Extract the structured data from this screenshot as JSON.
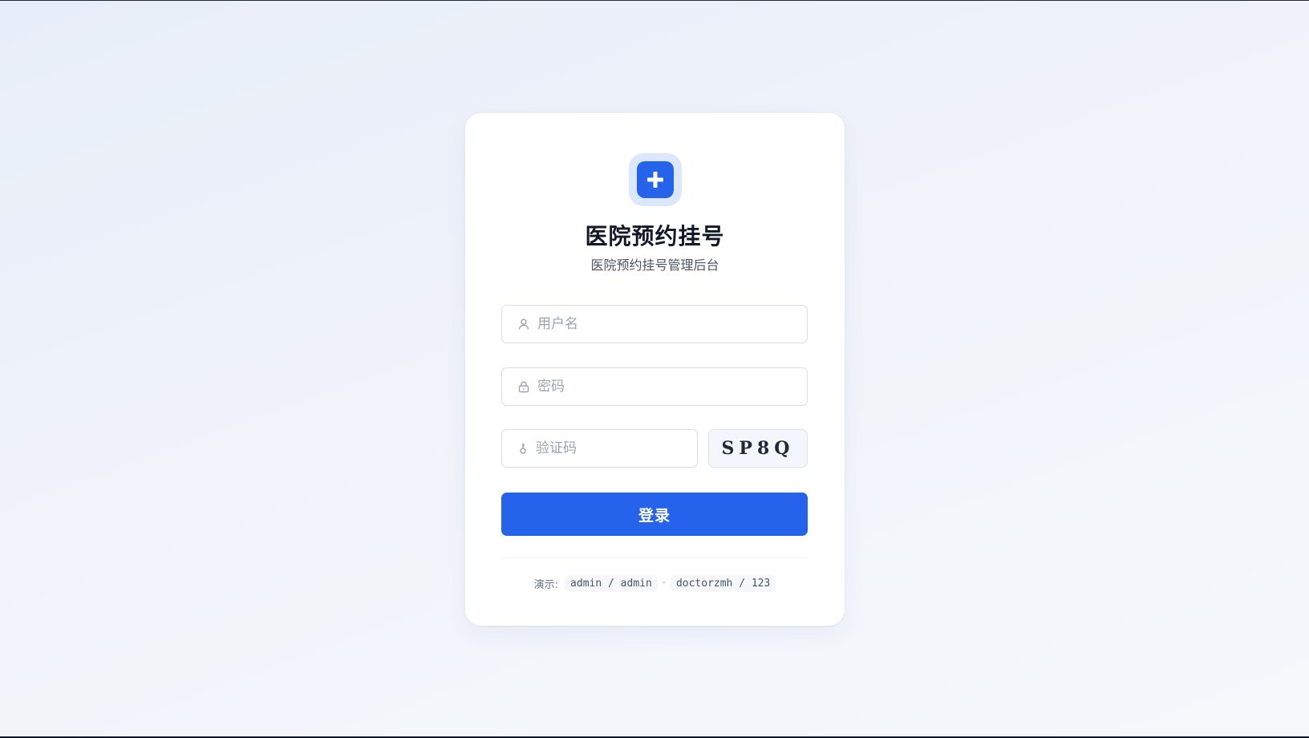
{
  "app": {
    "title": "医院预约挂号",
    "subtitle": "医院预约挂号管理后台",
    "logo_icon": "medical-cross-icon"
  },
  "form": {
    "username": {
      "placeholder": "用户名",
      "value": "",
      "icon": "user-icon"
    },
    "password": {
      "placeholder": "密码",
      "value": "",
      "icon": "lock-icon"
    },
    "captcha_input": {
      "placeholder": "验证码",
      "value": "",
      "icon": "key-icon"
    },
    "captcha_code": "SP8Q",
    "login_label": "登录"
  },
  "demo": {
    "label": "演示:",
    "account1": "admin / admin",
    "separator": "·",
    "account2": "doctorzmh / 123"
  },
  "colors": {
    "primary": "#2563eb",
    "logo_bg": "#dbe7fd",
    "title": "#111827",
    "background": "#eef2f9"
  }
}
